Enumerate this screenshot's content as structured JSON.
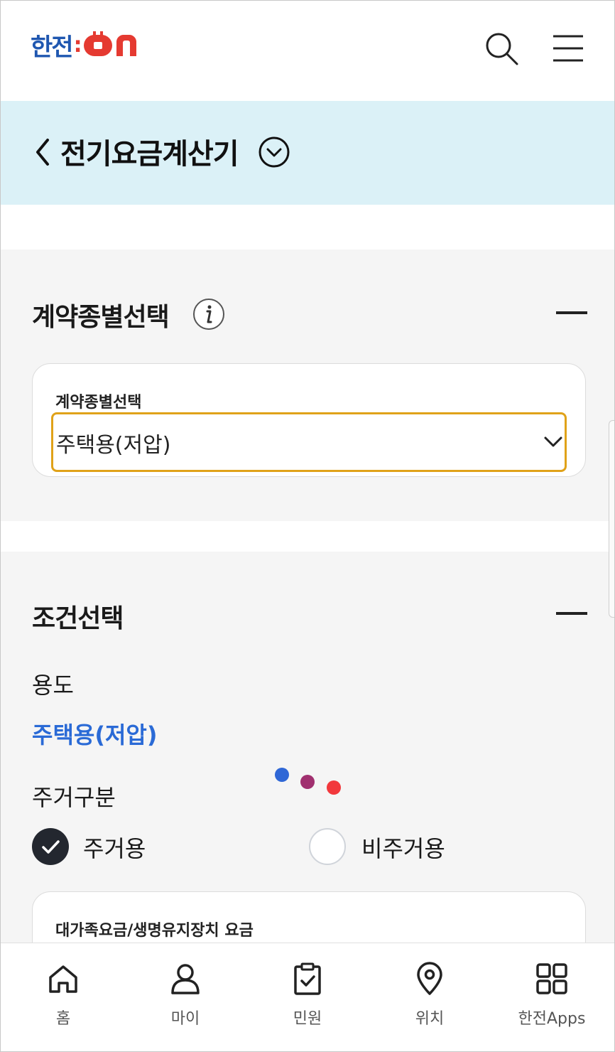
{
  "header": {
    "logo_kr": "한전",
    "logo_colon": ":",
    "logo_on": "ON",
    "brand_blue": "#1f57b0",
    "brand_red": "#e53a31"
  },
  "title_bar": {
    "title": "전기요금계산기"
  },
  "contract_section": {
    "heading": "계약종별선택",
    "card_label": "계약종별선택",
    "selected": "주택용(저압)",
    "focus_color": "#e0a219"
  },
  "condition_section": {
    "heading": "조건선택",
    "usage_label": "용도",
    "usage_value": "주택용(저압)",
    "residence_label": "주거구분",
    "options": [
      {
        "label": "주거용",
        "selected": true
      },
      {
        "label": "비주거용",
        "selected": false
      }
    ],
    "next_card_label": "대가족요금/생명유지장치 요금",
    "loading_dot_colors": [
      "#2f67d6",
      "#a0306f",
      "#f2383c"
    ]
  },
  "bottom_nav": [
    {
      "label": "홈",
      "icon": "home-icon"
    },
    {
      "label": "마이",
      "icon": "person-icon"
    },
    {
      "label": "민원",
      "icon": "clipboard-check-icon"
    },
    {
      "label": "위치",
      "icon": "location-pin-icon"
    },
    {
      "label": "한전Apps",
      "icon": "apps-grid-icon"
    }
  ]
}
